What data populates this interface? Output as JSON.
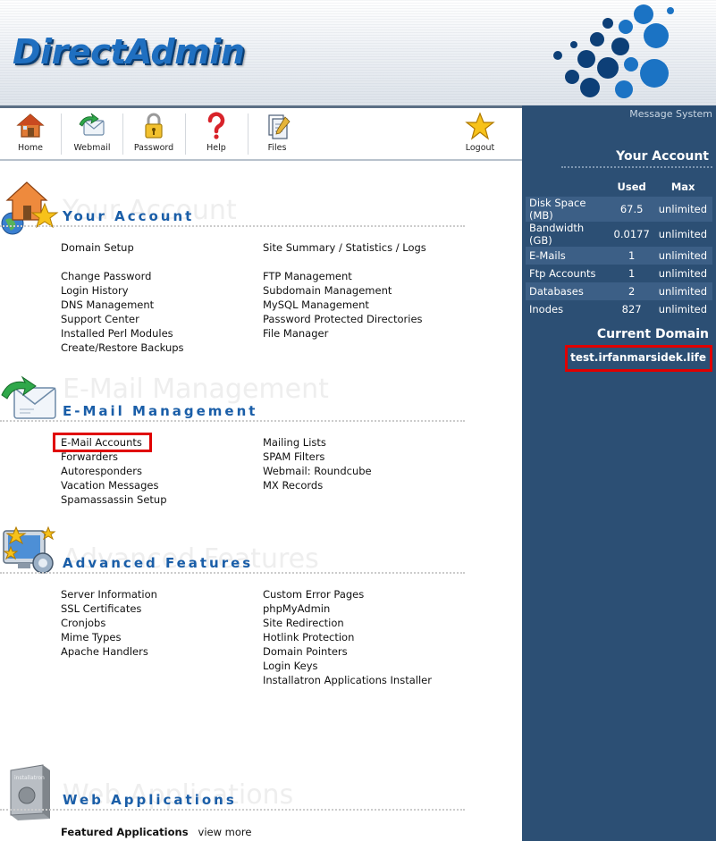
{
  "header": {
    "logo_text": "DirectAdmin"
  },
  "toolbar": {
    "items": [
      {
        "label": "Home",
        "icon": "house-icon"
      },
      {
        "label": "Webmail",
        "icon": "mail-icon"
      },
      {
        "label": "Password",
        "icon": "padlock-icon"
      },
      {
        "label": "Help",
        "icon": "question-icon"
      },
      {
        "label": "Files",
        "icon": "files-icon"
      },
      {
        "label": "Logout",
        "icon": "star-icon"
      }
    ]
  },
  "sidebar": {
    "message_system": "Message System",
    "your_account_title": "Your Account",
    "usage_headers": {
      "used": "Used",
      "max": "Max"
    },
    "usage": [
      {
        "label": "Disk Space (MB)",
        "used": "67.5",
        "max": "unlimited"
      },
      {
        "label": "Bandwidth (GB)",
        "used": "0.0177",
        "max": "unlimited"
      },
      {
        "label": "E-Mails",
        "used": "1",
        "max": "unlimited"
      },
      {
        "label": "Ftp Accounts",
        "used": "1",
        "max": "unlimited"
      },
      {
        "label": "Databases",
        "used": "2",
        "max": "unlimited"
      },
      {
        "label": "Inodes",
        "used": "827",
        "max": "unlimited"
      }
    ],
    "current_domain_title": "Current Domain",
    "current_domain": "test.irfanmarsidek.life"
  },
  "sections": {
    "your_account": {
      "ghost": "Your Account",
      "title": "Your Account",
      "left": [
        "Domain Setup",
        "",
        "Change Password",
        "Login History",
        "DNS Management",
        "Support Center",
        "Installed Perl Modules",
        "Create/Restore Backups"
      ],
      "right": [
        "Site Summary / Statistics / Logs",
        "",
        "FTP Management",
        "Subdomain Management",
        "MySQL Management",
        "Password Protected Directories",
        "File Manager"
      ]
    },
    "email": {
      "ghost": "E-Mail Management",
      "title": "E-Mail Management",
      "left": [
        "E-Mail Accounts",
        "Forwarders",
        "Autoresponders",
        "Vacation Messages",
        "Spamassassin Setup"
      ],
      "right": [
        "Mailing Lists",
        "SPAM Filters",
        "Webmail: Roundcube",
        "MX Records"
      ]
    },
    "advanced": {
      "ghost": "Advanced Features",
      "title": "Advanced Features",
      "left": [
        "Server Information",
        "SSL Certificates",
        "Cronjobs",
        "Mime Types",
        "Apache Handlers"
      ],
      "right": [
        "Custom Error Pages",
        "phpMyAdmin",
        "Site Redirection",
        "Hotlink Protection",
        "Domain Pointers",
        "Login Keys",
        "Installatron Applications Installer"
      ]
    },
    "webapps": {
      "ghost": "Web Applications",
      "title": "Web Applications",
      "featured_label": "Featured Applications",
      "view_more": "view more",
      "icon_text": "installatron"
    }
  },
  "colors": {
    "sidebar_bg": "#2c4f74",
    "title_blue": "#1a5ea8",
    "highlight_red": "#e00000"
  }
}
